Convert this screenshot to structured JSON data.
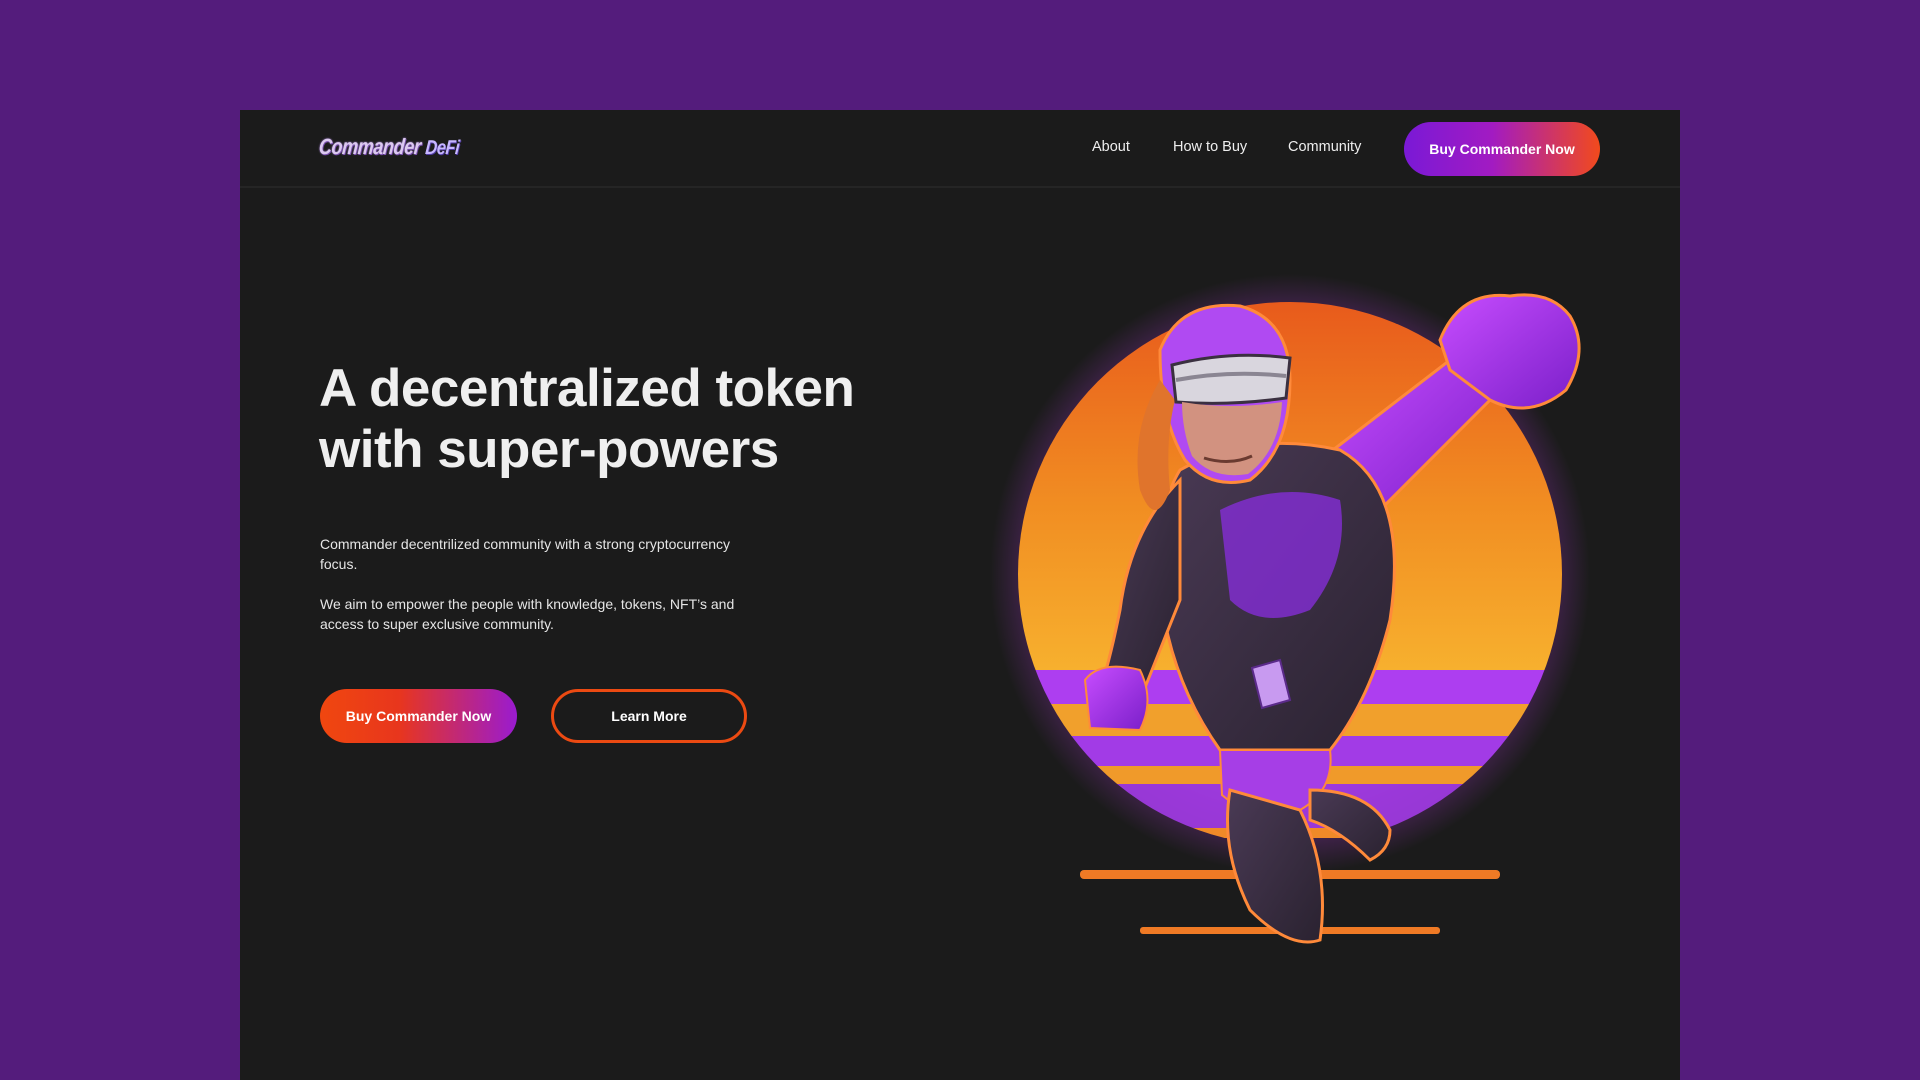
{
  "brand": {
    "logo_part1": "Commander",
    "logo_part2": "DeFi"
  },
  "nav": {
    "links": [
      {
        "label": "About"
      },
      {
        "label": "How to Buy"
      },
      {
        "label": "Community"
      }
    ],
    "cta_label": "Buy Commander Now"
  },
  "hero": {
    "headline_line1": "A decentralized token",
    "headline_line2": "with super-powers",
    "paragraph1": "Commander decentrilized community with a strong cryptocurrency focus.",
    "paragraph2": "We aim to empower the people with knowledge,  tokens, NFT’s and access to super exclusive community.",
    "primary_button": "Buy Commander Now",
    "secondary_button": "Learn More"
  },
  "colors": {
    "page_background": "#541c7c",
    "panel_background": "#1b1b1b",
    "accent_purple": "#8a1bd6",
    "accent_orange": "#f0470f"
  }
}
